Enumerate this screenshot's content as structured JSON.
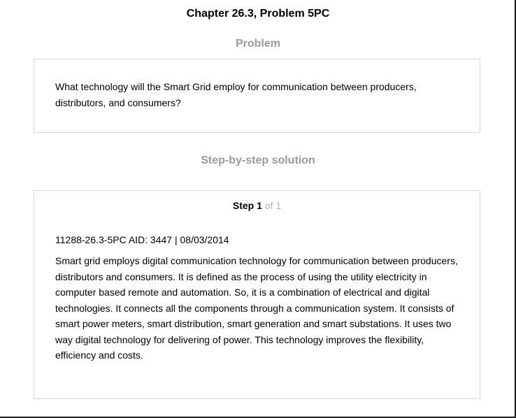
{
  "header": {
    "title": "Chapter 26.3, Problem 5PC"
  },
  "problem": {
    "heading": "Problem",
    "text": "What technology will the Smart Grid employ for communication between producers, distributors, and consumers?"
  },
  "solution": {
    "heading": "Step-by-step solution",
    "step": {
      "label": "Step",
      "number": "1",
      "of_text": "of 1"
    },
    "meta": "11288-26.3-5PC AID: 3447 | 08/03/2014",
    "text": "Smart grid employs digital communication technology for communication between producers, distributors and consumers. It is defined as the process of using the utility electricity in computer based remote and automation. So, it is a combination of electrical and digital technologies. It connects all the components through a communication system. It consists of smart power meters, smart distribution, smart generation and smart substations. It uses two way digital technology for delivering of power. This technology improves the flexibility, efficiency and costs."
  }
}
